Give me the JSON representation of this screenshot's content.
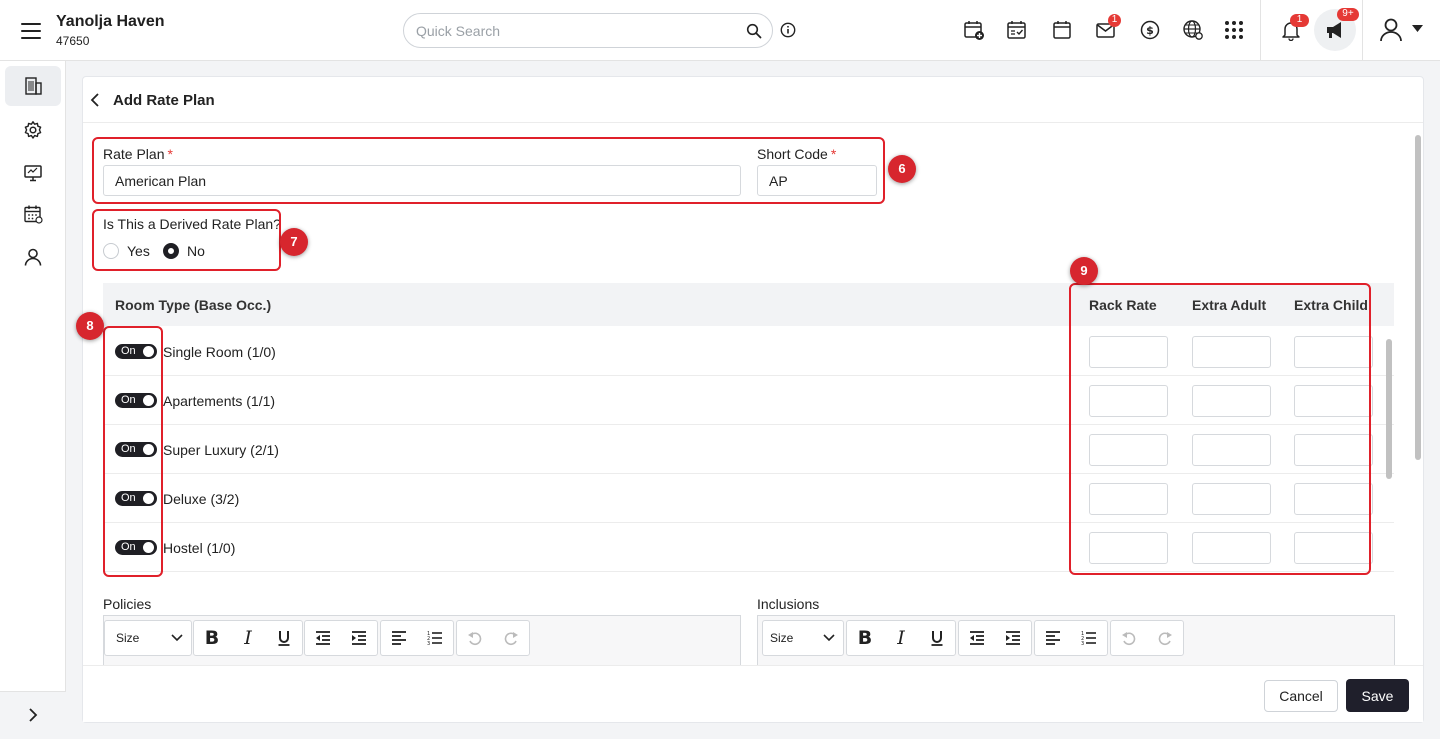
{
  "header": {
    "hotel_name": "Yanolja Haven",
    "hotel_id": "47650",
    "search_placeholder": "Quick Search",
    "mail_badge": "1",
    "notification_badge": "1",
    "announcement_badge": "9+"
  },
  "page": {
    "title": "Add Rate Plan"
  },
  "form": {
    "rate_plan_label": "Rate Plan",
    "rate_plan_value": "American Plan",
    "short_code_label": "Short Code",
    "short_code_value": "AP",
    "required_mark": "*",
    "derived_question": "Is This a Derived Rate Plan?",
    "derived_yes": "Yes",
    "derived_no": "No",
    "derived_selected": "No"
  },
  "room_table": {
    "col_room_type": "Room Type (Base Occ.)",
    "col_rack_rate": "Rack Rate",
    "col_extra_adult": "Extra Adult",
    "col_extra_child": "Extra Child",
    "toggle_label": "On",
    "rows": [
      {
        "name": "Single Room (1/0)",
        "enabled": true
      },
      {
        "name": "Apartements (1/1)",
        "enabled": true
      },
      {
        "name": "Super Luxury (2/1)",
        "enabled": true
      },
      {
        "name": "Deluxe (3/2)",
        "enabled": true
      },
      {
        "name": "Hostel (1/0)",
        "enabled": true
      }
    ]
  },
  "policies": {
    "label": "Policies",
    "size_label": "Size"
  },
  "inclusions": {
    "label": "Inclusions",
    "size_label": "Size"
  },
  "markers": {
    "m6": "6",
    "m7": "7",
    "m8": "8",
    "m9": "9"
  },
  "footer": {
    "cancel_label": "Cancel",
    "save_label": "Save"
  },
  "colors": {
    "highlight": "#e0202a",
    "marker": "#d7262e",
    "primary_dark": "#1f1f2b",
    "badge": "#e53935"
  }
}
